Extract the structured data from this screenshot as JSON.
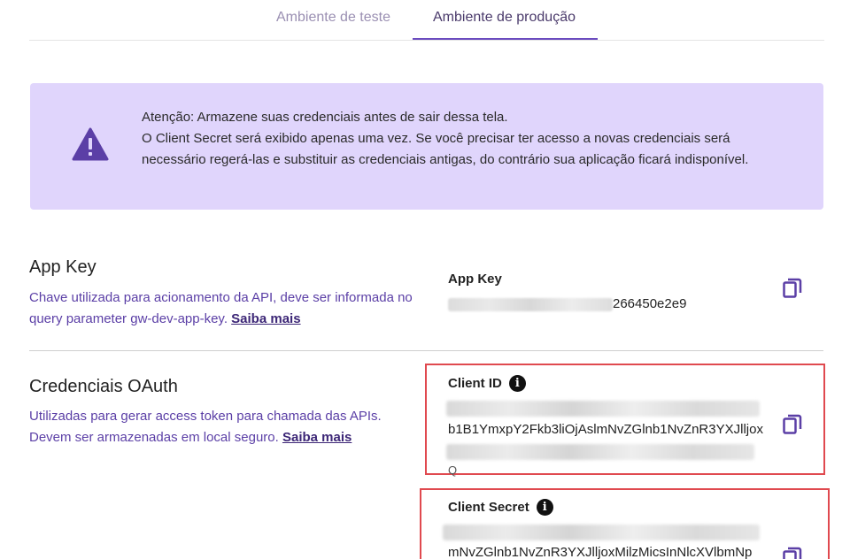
{
  "tabs": [
    {
      "label": "Ambiente de teste",
      "active": false
    },
    {
      "label": "Ambiente de produção",
      "active": true
    }
  ],
  "alert": {
    "icon": "warning-triangle-icon",
    "line1": "Atenção: Armazene suas credenciais antes de sair dessa tela.",
    "line2": "O Client Secret será exibido apenas uma vez. Se você precisar ter acesso a novas credenciais será necessário regerá-las e substituir as credenciais antigas, do contrário sua aplicação ficará indisponível."
  },
  "app_key": {
    "title": "App Key",
    "desc": "Chave utilizada para acionamento da API, deve ser informada no query parameter gw-dev-app-key.",
    "link": "Saiba mais",
    "field_label": "App Key",
    "value_visible": "266450e2e9"
  },
  "oauth": {
    "title": "Credenciais OAuth",
    "desc": "Utilizadas para gerar access token para chamada das APIs. Devem ser armazenadas em local seguro.",
    "link": "Saiba mais",
    "client_id_label": "Client ID",
    "client_id_visible": "b1B1YmxpY2Fkb3liOjAslmNvZGlnb1NvZnR3YXJlljox",
    "client_id_tail": "Q",
    "client_secret_label": "Client Secret",
    "client_secret_visible": "mNvZGlnb1NvZnR3YXJlljoxMilzMicsInNlcXVlbmNp"
  },
  "colors": {
    "accent": "#6b4bbf",
    "alert_bg": "#e0d5fc",
    "link": "#5b3fa6",
    "highlight_border": "#e0494f"
  }
}
